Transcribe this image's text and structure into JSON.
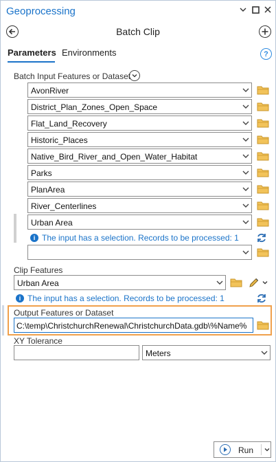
{
  "window": {
    "title": "Geoprocessing"
  },
  "tool": {
    "title": "Batch Clip"
  },
  "tabs": [
    {
      "label": "Parameters"
    },
    {
      "label": "Environments"
    }
  ],
  "batch_input": {
    "label": "Batch Input Features or Dataset",
    "items": [
      "AvonRiver",
      "District_Plan_Zones_Open_Space",
      "Flat_Land_Recovery",
      "Historic_Places",
      "Native_Bird_River_and_Open_Water_Habitat",
      "Parks",
      "PlanArea",
      "River_Centerlines",
      "Urban Area"
    ],
    "selection_message": "The input has a selection. Records to be processed: 1",
    "empty_value": ""
  },
  "clip_features": {
    "label": "Clip Features",
    "value": "Urban Area",
    "selection_message": "The input has a selection. Records to be processed: 1"
  },
  "output": {
    "label": "Output Features or Dataset",
    "value": "C:\\temp\\ChristchurchRenewal\\ChristchurchData.gdb\\%Name%"
  },
  "xy_tolerance": {
    "label": "XY Tolerance",
    "value": "",
    "unit": "Meters"
  },
  "run": {
    "label": "Run"
  },
  "icons": {
    "back": "back-arrow-icon",
    "add": "add-icon",
    "help": "help-icon",
    "folder": "folder-icon",
    "refresh": "refresh-icon",
    "info": "info-icon"
  },
  "colors": {
    "accent": "#1a73c9",
    "folder": "#e8b84a",
    "highlight": "#f0a04b"
  }
}
